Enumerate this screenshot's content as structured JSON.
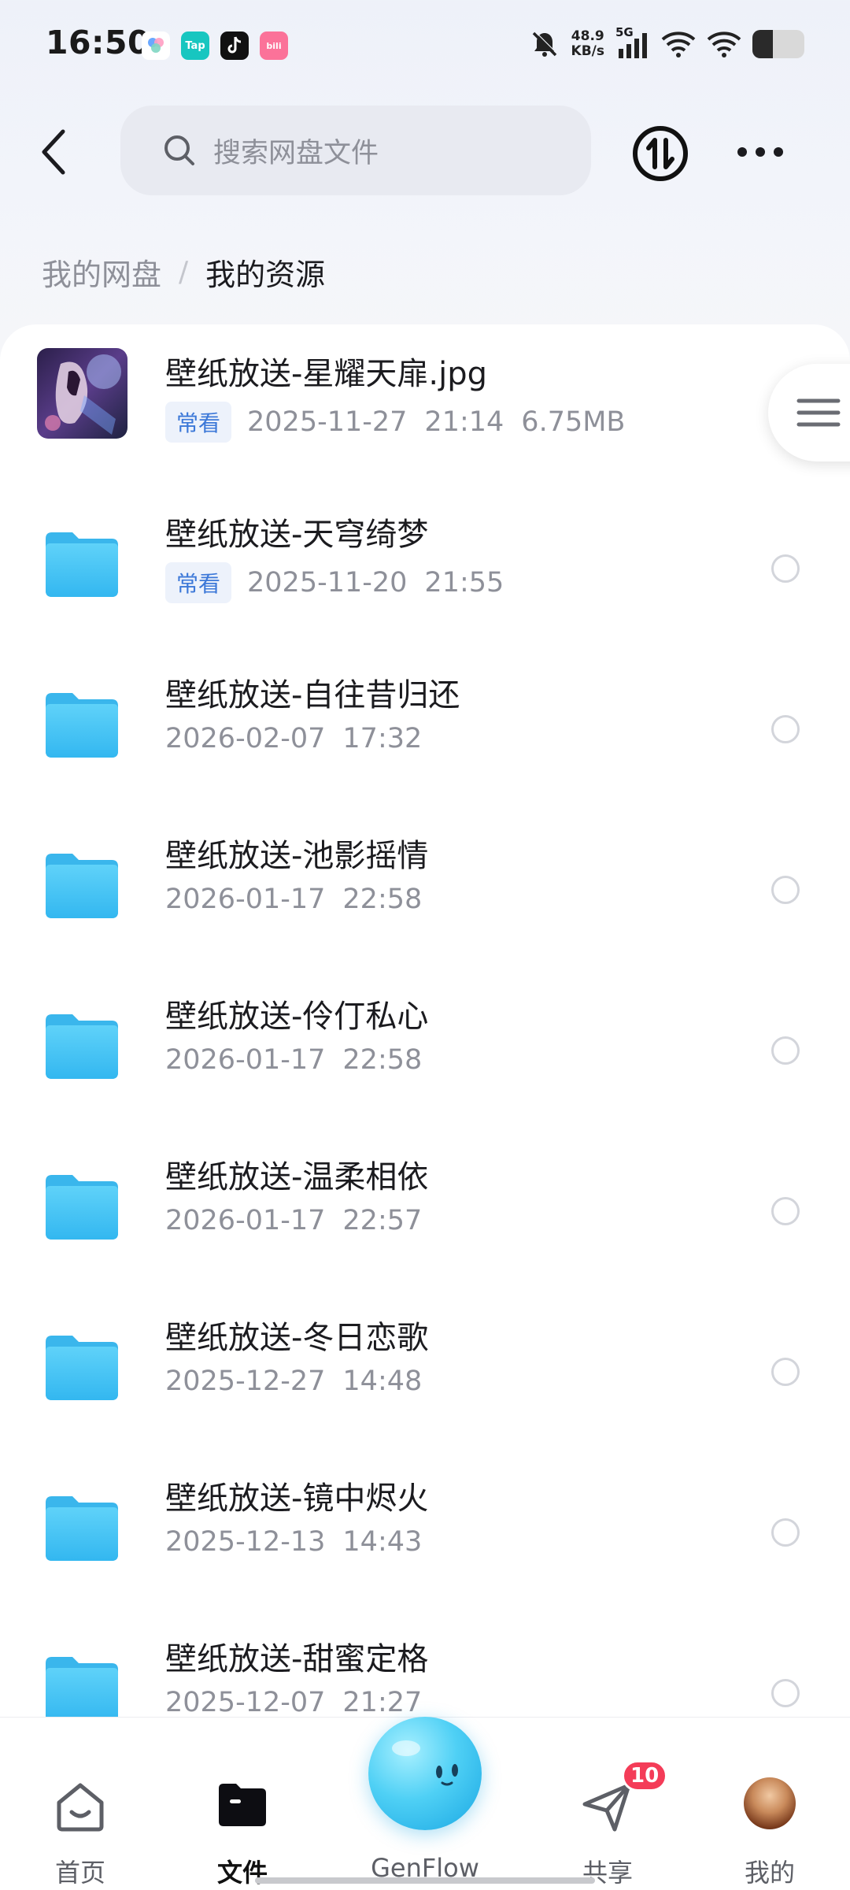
{
  "status_bar": {
    "time": "16:50",
    "net_speed_value": "48.9",
    "net_speed_unit": "KB/s",
    "network": "5G",
    "apps": [
      {
        "icon": "pinwheel-app-icon",
        "label": ""
      },
      {
        "icon": "taptap-app-icon",
        "label": "Tap"
      },
      {
        "icon": "tiktok-app-icon",
        "label": ""
      },
      {
        "icon": "bilibili-app-icon",
        "label": "bili"
      }
    ],
    "battery_level": 0.4
  },
  "header": {
    "search_placeholder": "搜索网盘文件"
  },
  "breadcrumb": {
    "root": "我的网盘",
    "separator": "/",
    "current": "我的资源"
  },
  "files": [
    {
      "type": "image",
      "name": "壁纸放送-星耀天扉.jpg",
      "tag": "常看",
      "date": "2025-11-27",
      "time": "21:14",
      "size": "6.75MB"
    },
    {
      "type": "folder",
      "name": "壁纸放送-天穹绮梦",
      "tag": "常看",
      "date": "2025-11-20",
      "time": "21:55",
      "size": ""
    },
    {
      "type": "folder",
      "name": "壁纸放送-自往昔归还",
      "tag": "",
      "date": "2026-02-07",
      "time": "17:32",
      "size": ""
    },
    {
      "type": "folder",
      "name": "壁纸放送-池影摇情",
      "tag": "",
      "date": "2026-01-17",
      "time": "22:58",
      "size": ""
    },
    {
      "type": "folder",
      "name": "壁纸放送-伶仃私心",
      "tag": "",
      "date": "2026-01-17",
      "time": "22:58",
      "size": ""
    },
    {
      "type": "folder",
      "name": "壁纸放送-温柔相依",
      "tag": "",
      "date": "2026-01-17",
      "time": "22:57",
      "size": ""
    },
    {
      "type": "folder",
      "name": "壁纸放送-冬日恋歌",
      "tag": "",
      "date": "2025-12-27",
      "time": "14:48",
      "size": ""
    },
    {
      "type": "folder",
      "name": "壁纸放送-镜中烬火",
      "tag": "",
      "date": "2025-12-13",
      "time": "14:43",
      "size": ""
    },
    {
      "type": "folder",
      "name": "壁纸放送-甜蜜定格",
      "tag": "",
      "date": "2025-12-07",
      "time": "21:27",
      "size": ""
    }
  ],
  "bottom_nav": {
    "home": "首页",
    "files": "文件",
    "genflow": "GenFlow",
    "share": "共享",
    "share_badge": "10",
    "mine": "我的"
  },
  "colors": {
    "accent": "#3c78d8",
    "folder": "#45c2f5",
    "badge": "#f43c58"
  }
}
